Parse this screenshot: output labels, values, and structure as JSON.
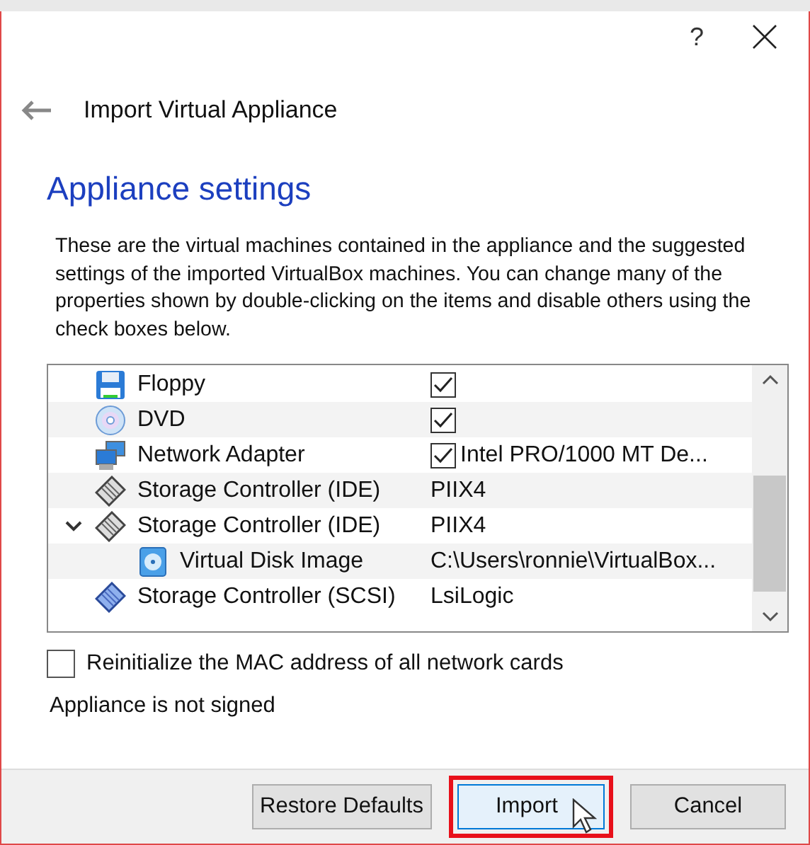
{
  "window": {
    "help": "?"
  },
  "header": {
    "title": "Import Virtual Appliance"
  },
  "heading": "Appliance settings",
  "description": "These are the virtual machines contained in the appliance and the suggested settings of the imported VirtualBox machines. You can change many of the properties shown by double-clicking on the items and disable others using the check boxes below.",
  "rows": [
    {
      "kind": "floppy",
      "name": "Floppy",
      "checked": true
    },
    {
      "kind": "dvd",
      "name": "DVD",
      "checked": true
    },
    {
      "kind": "network",
      "name": "Network Adapter",
      "checked": true,
      "value": "Intel PRO/1000 MT De..."
    },
    {
      "kind": "storage",
      "name": "Storage Controller (IDE)",
      "value": "PIIX4"
    },
    {
      "kind": "storage",
      "name": "Storage Controller (IDE)",
      "value": "PIIX4",
      "expanded": true,
      "children": [
        {
          "kind": "disk",
          "name": "Virtual Disk Image",
          "value": "C:\\Users\\ronnie\\VirtualBox..."
        }
      ]
    },
    {
      "kind": "scsi",
      "name": "Storage Controller (SCSI)",
      "value": "LsiLogic"
    }
  ],
  "reinit_mac": {
    "label": "Reinitialize the MAC address of all network cards",
    "checked": false
  },
  "signature": "Appliance is not signed",
  "buttons": [
    {
      "label": "Restore Defaults",
      "highlighted": false
    },
    {
      "label": "Import",
      "highlighted": true
    },
    {
      "label": "Cancel",
      "highlighted": false
    }
  ]
}
